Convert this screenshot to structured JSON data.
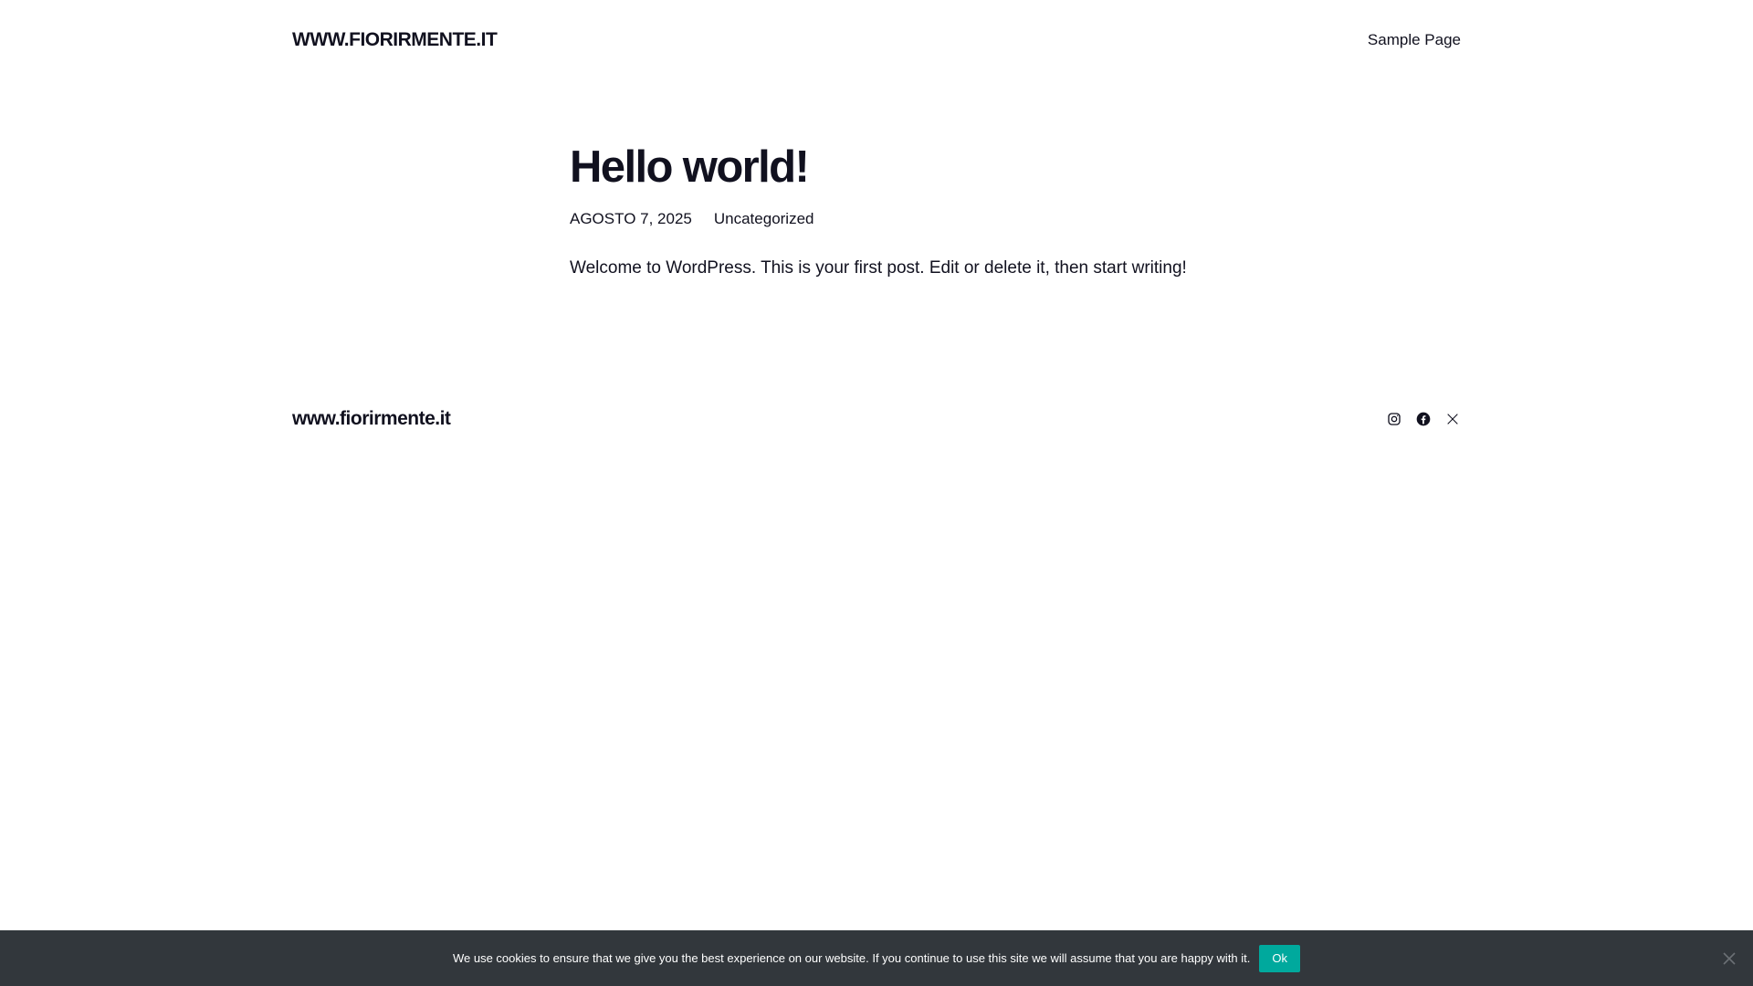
{
  "header": {
    "site_title": "WWW.FIORIRMENTE.IT",
    "nav": [
      {
        "label": "Sample Page"
      }
    ]
  },
  "post": {
    "title": "Hello world!",
    "date": "AGOSTO 7, 2025",
    "category": "Uncategorized",
    "content": "Welcome to WordPress. This is your first post. Edit or delete it, then start writing!"
  },
  "footer": {
    "site_title": "www.fiorirmente.it",
    "social": [
      {
        "icon": "instagram-icon"
      },
      {
        "icon": "facebook-icon"
      },
      {
        "icon": "x-icon"
      }
    ]
  },
  "cookie_notice": {
    "text": "We use cookies to ensure that we give you the best experience on our website. If you continue to use this site we will assume that you are happy with it.",
    "ok_label": "Ok",
    "button_color": "#00a99d",
    "bar_color": "#32373c"
  }
}
